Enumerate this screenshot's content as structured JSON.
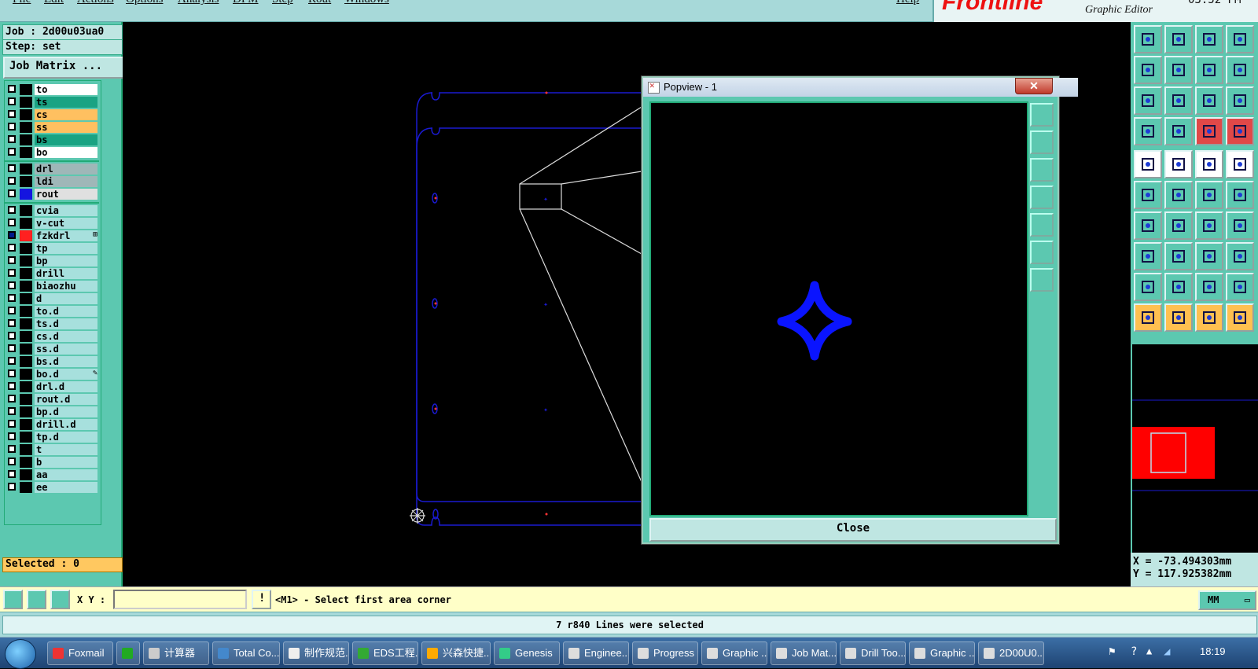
{
  "menu": [
    "File",
    "Edit",
    "Actions",
    "Options",
    "Analysis",
    "DFM",
    "Step",
    "Rout",
    "Windows",
    "Help"
  ],
  "brand": {
    "logo": "Frontline",
    "editor": "Graphic Editor",
    "clock": "03:52 PM"
  },
  "job": {
    "job_label": "Job : 2d00u03ua0",
    "step_label": "Step: set",
    "job_matrix": "Job Matrix ..."
  },
  "layers": [
    {
      "name": "to",
      "bg": "#ffffff",
      "mark": ""
    },
    {
      "name": "ts",
      "bg": "#1aa383",
      "mark": ""
    },
    {
      "name": "cs",
      "bg": "#ffc060",
      "mark": ""
    },
    {
      "name": "ss",
      "bg": "#ffc060",
      "mark": ""
    },
    {
      "name": "bs",
      "bg": "#1aa383",
      "mark": ""
    },
    {
      "name": "bo",
      "bg": "#ffffff",
      "mark": ""
    },
    {
      "name": "drl",
      "bg": "#9fb7b8",
      "mark": ""
    },
    {
      "name": "ldi",
      "bg": "#9fb7b8",
      "mark": ""
    },
    {
      "name": "rout",
      "bg": "#e0e0e0",
      "mark": ""
    },
    {
      "name": "cvia",
      "bg": "#a7e0dd",
      "mark": ""
    },
    {
      "name": "v-cut",
      "bg": "#a7e0dd",
      "mark": ""
    },
    {
      "name": "fzkdrl",
      "bg": "#a7e0dd",
      "mark": "⊞"
    },
    {
      "name": "tp",
      "bg": "#a7e0dd",
      "mark": ""
    },
    {
      "name": "bp",
      "bg": "#a7e0dd",
      "mark": ""
    },
    {
      "name": "drill",
      "bg": "#a7e0dd",
      "mark": ""
    },
    {
      "name": "biaozhu",
      "bg": "#a7e0dd",
      "mark": ""
    },
    {
      "name": "d",
      "bg": "#a7e0dd",
      "mark": ""
    },
    {
      "name": "to.d",
      "bg": "#a7e0dd",
      "mark": ""
    },
    {
      "name": "ts.d",
      "bg": "#a7e0dd",
      "mark": ""
    },
    {
      "name": "cs.d",
      "bg": "#a7e0dd",
      "mark": ""
    },
    {
      "name": "ss.d",
      "bg": "#a7e0dd",
      "mark": ""
    },
    {
      "name": "bs.d",
      "bg": "#a7e0dd",
      "mark": ""
    },
    {
      "name": "bo.d",
      "bg": "#a7e0dd",
      "mark": "✎"
    },
    {
      "name": "drl.d",
      "bg": "#a7e0dd",
      "mark": ""
    },
    {
      "name": "rout.d",
      "bg": "#a7e0dd",
      "mark": ""
    },
    {
      "name": "bp.d",
      "bg": "#a7e0dd",
      "mark": ""
    },
    {
      "name": "drill.d",
      "bg": "#a7e0dd",
      "mark": ""
    },
    {
      "name": "tp.d",
      "bg": "#a7e0dd",
      "mark": ""
    },
    {
      "name": "t",
      "bg": "#a7e0dd",
      "mark": ""
    },
    {
      "name": "b",
      "bg": "#a7e0dd",
      "mark": ""
    },
    {
      "name": "aa",
      "bg": "#a7e0dd",
      "mark": ""
    },
    {
      "name": "ee",
      "bg": "#a7e0dd",
      "mark": ""
    }
  ],
  "selected_label": "Selected : 0",
  "popview": {
    "title": "Popview - 1",
    "close_x": "✕",
    "close_button": "Close"
  },
  "coords": {
    "x": "X = -73.494303mm",
    "y": "Y = 117.925382mm"
  },
  "cmd": {
    "xy_label": "X Y :",
    "xy_value": "",
    "prompt": "<M1> - Select first area corner",
    "units": "MM"
  },
  "status": "7 r840 Lines were selected",
  "taskbar": {
    "items": [
      {
        "label": "Foxmail",
        "color": "#e33"
      },
      {
        "label": "",
        "color": "#2a2"
      },
      {
        "label": "计算器",
        "color": "#ccc"
      },
      {
        "label": "Total Co...",
        "color": "#48c"
      },
      {
        "label": "制作规范...",
        "color": "#eee"
      },
      {
        "label": "EDS工程...",
        "color": "#3a3"
      },
      {
        "label": "兴森快捷...",
        "color": "#fa0"
      },
      {
        "label": "Genesis",
        "color": "#3c8"
      },
      {
        "label": "Enginee...",
        "color": "#ddd"
      },
      {
        "label": "Progress",
        "color": "#ddd"
      },
      {
        "label": "Graphic ...",
        "color": "#ddd"
      },
      {
        "label": "Job Mat...",
        "color": "#ddd"
      },
      {
        "label": "Drill Too...",
        "color": "#ddd"
      },
      {
        "label": "Graphic ...",
        "color": "#ddd"
      },
      {
        "label": "2D00U0...",
        "color": "#ddd"
      }
    ],
    "clock": "18:19"
  }
}
